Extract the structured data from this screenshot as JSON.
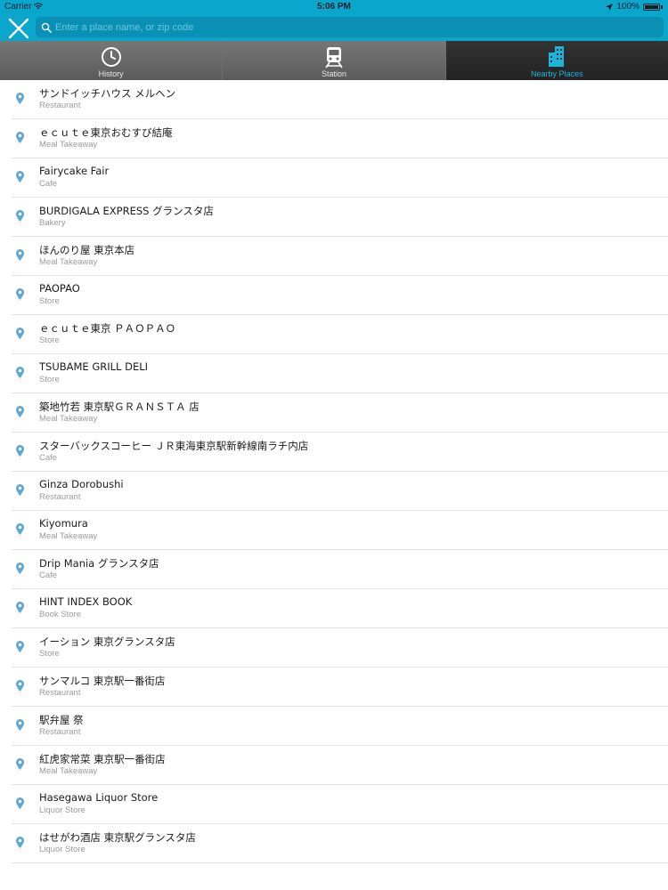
{
  "status": {
    "carrier": "Carrier",
    "time": "5:06 PM",
    "battery": "100%"
  },
  "search": {
    "placeholder": "Enter a place name, or zip code",
    "value": ""
  },
  "tabs": [
    {
      "label": "History",
      "icon": "clock-icon",
      "active": false
    },
    {
      "label": "Station",
      "icon": "train-icon",
      "active": false
    },
    {
      "label": "Nearby Places",
      "icon": "buildings-icon",
      "active": true
    }
  ],
  "colors": {
    "accent": "#0aa6cc",
    "pin": "#5aa7d8"
  },
  "places": [
    {
      "name": "サンドイッチハウス メルヘン",
      "category": "Restaurant"
    },
    {
      "name": "ｅｃｕｔｅ東京おむすび結庵",
      "category": "Meal Takeaway"
    },
    {
      "name": "Fairycake Fair",
      "category": "Cafe"
    },
    {
      "name": "BURDIGALA EXPRESS グランスタ店",
      "category": "Bakery"
    },
    {
      "name": "ほんのり屋 東京本店",
      "category": "Meal Takeaway"
    },
    {
      "name": "PAOPAO",
      "category": "Store"
    },
    {
      "name": "ｅｃｕｔｅ東京 ＰＡＯＰＡＯ",
      "category": "Store"
    },
    {
      "name": "TSUBAME GRILL DELI",
      "category": "Store"
    },
    {
      "name": "築地竹若 東京駅ＧＲＡＮＳＴＡ 店",
      "category": "Meal Takeaway"
    },
    {
      "name": "スターバックスコーヒー ＪＲ東海東京駅新幹線南ラチ内店",
      "category": "Cafe"
    },
    {
      "name": "Ginza Dorobushi",
      "category": "Restaurant"
    },
    {
      "name": "Kiyomura",
      "category": "Meal Takeaway"
    },
    {
      "name": "Drip Mania グランスタ店",
      "category": "Cafe"
    },
    {
      "name": "HINT INDEX BOOK",
      "category": "Book Store"
    },
    {
      "name": "イーション 東京グランスタ店",
      "category": "Store"
    },
    {
      "name": "サンマルコ 東京駅一番街店",
      "category": "Restaurant"
    },
    {
      "name": "駅弁屋 祭",
      "category": "Restaurant"
    },
    {
      "name": "紅虎家常菜 東京駅一番街店",
      "category": "Meal Takeaway"
    },
    {
      "name": "Hasegawa Liquor Store",
      "category": "Liquor Store"
    },
    {
      "name": "はせがわ酒店 東京駅グランスタ店",
      "category": "Liquor Store"
    }
  ]
}
